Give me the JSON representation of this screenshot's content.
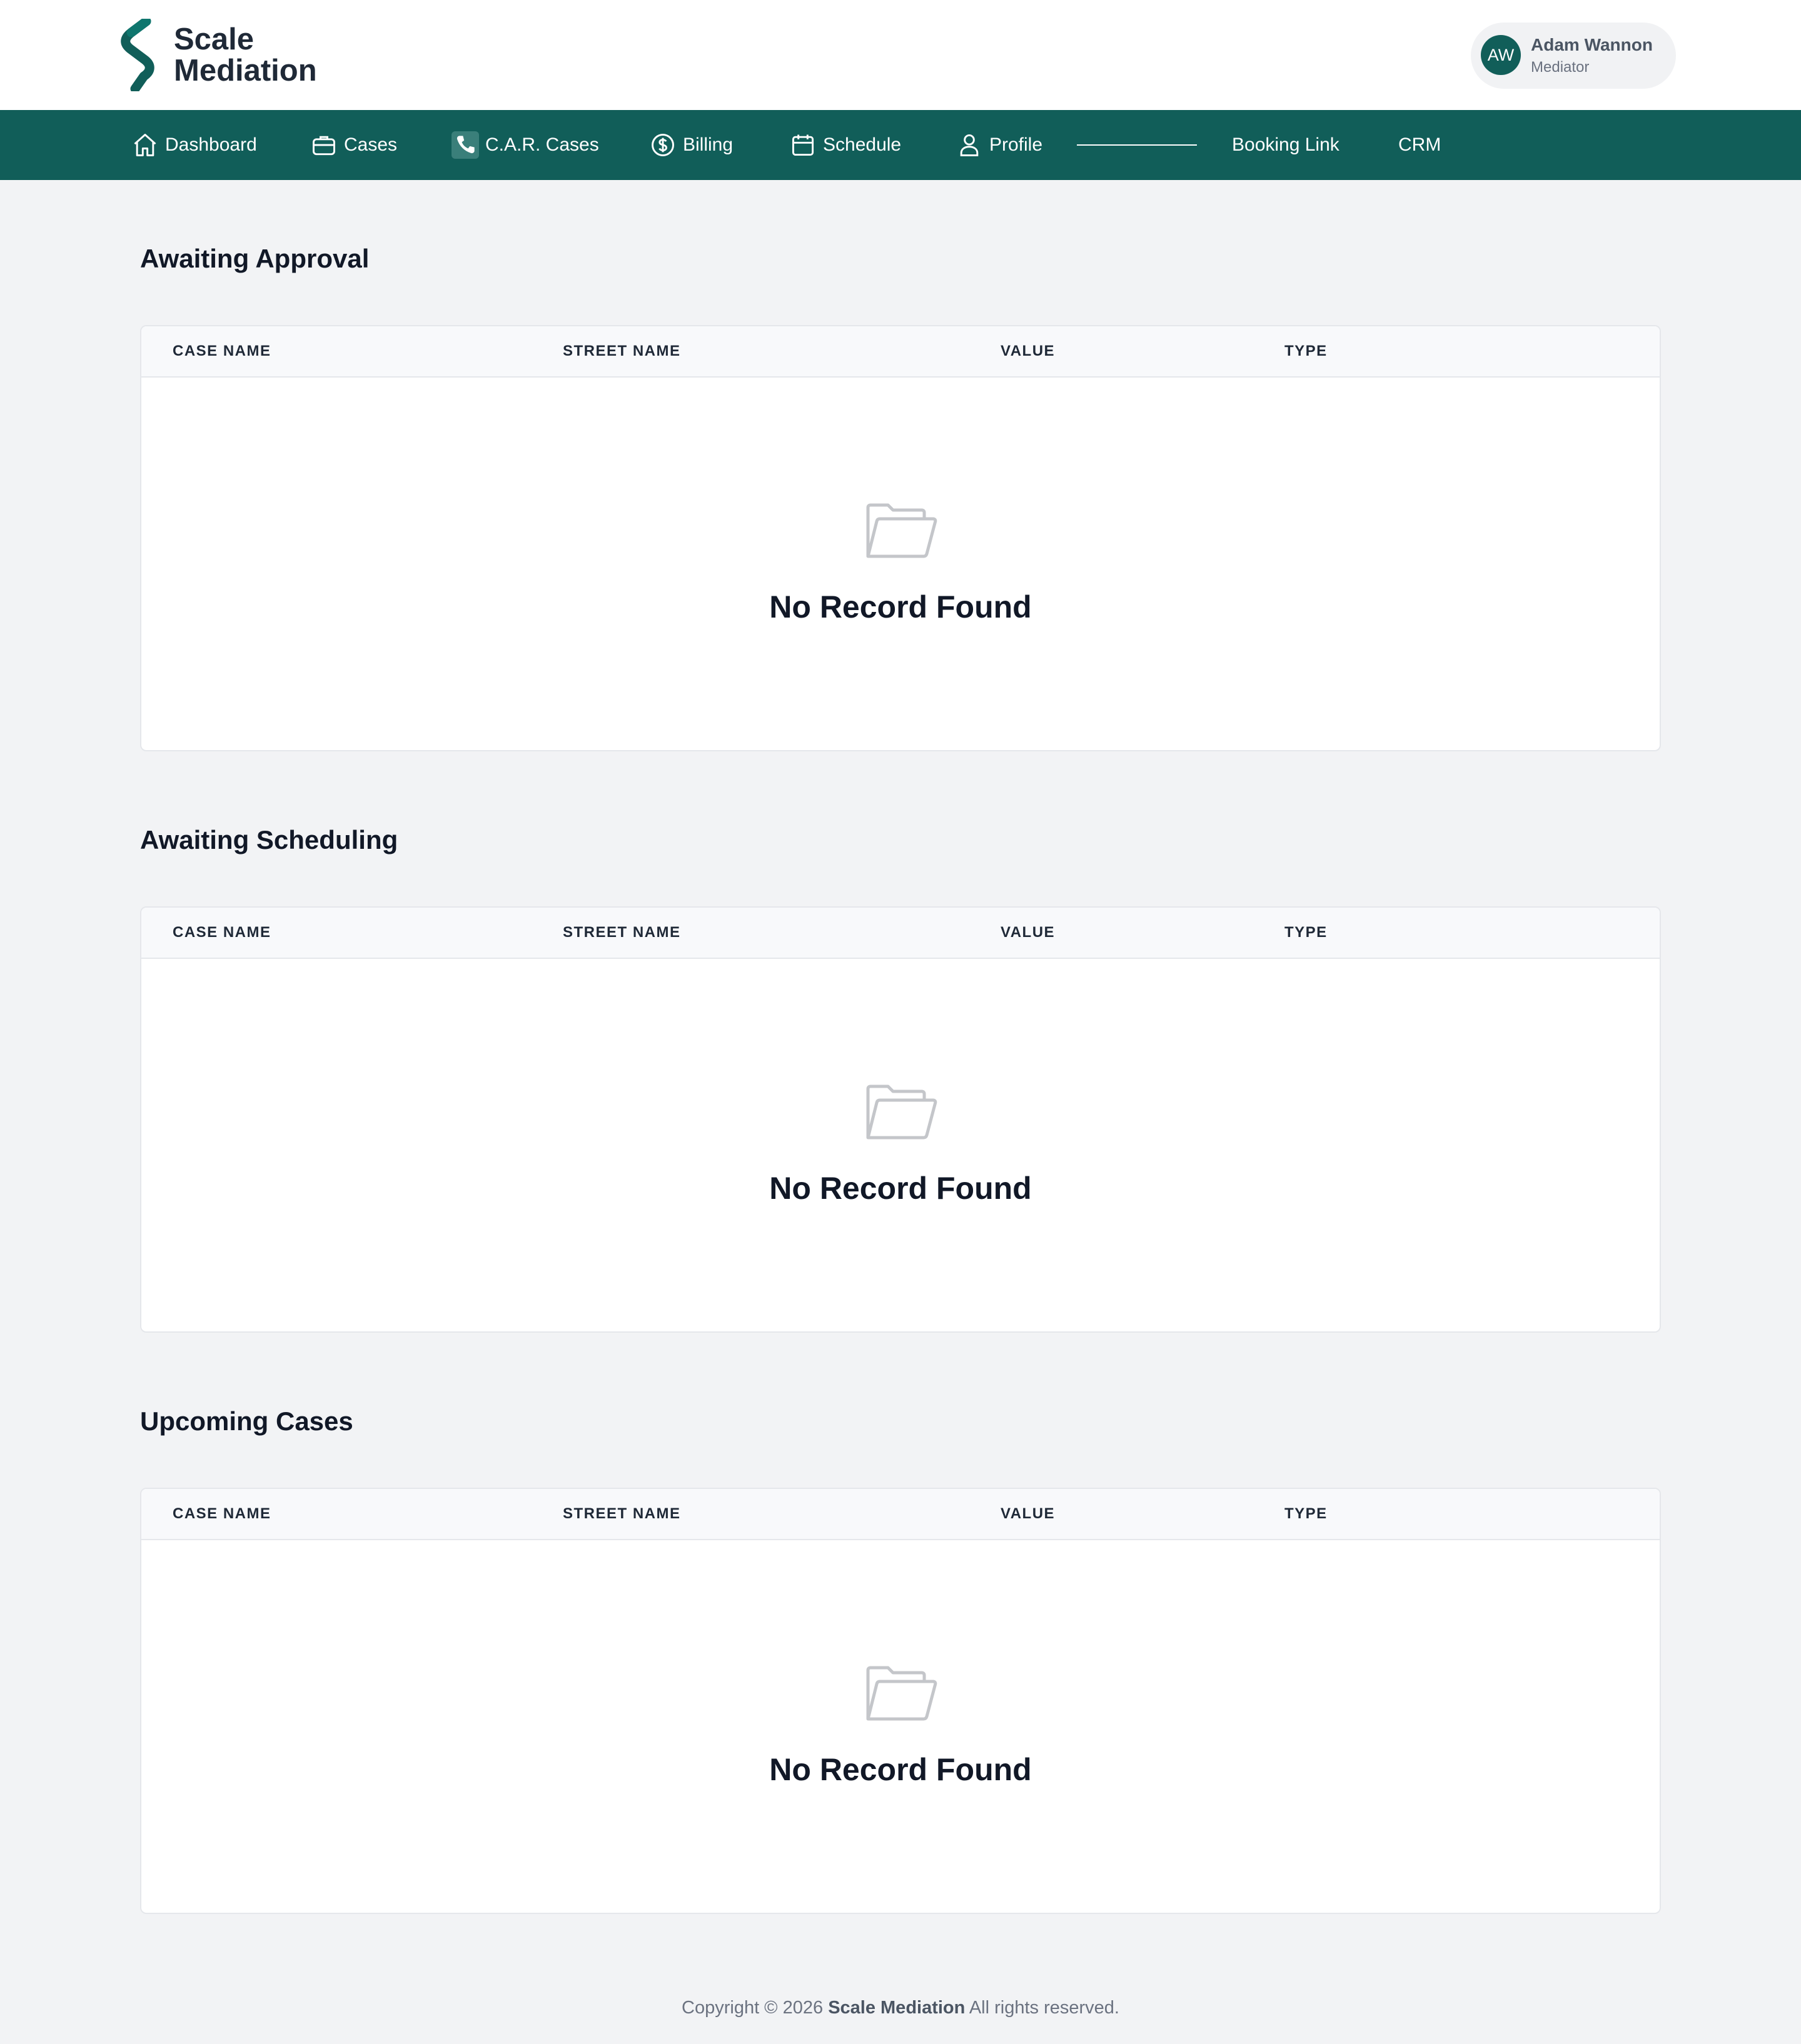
{
  "brand": {
    "line1": "Scale",
    "line2": "Mediation",
    "accent": "#115e59"
  },
  "user": {
    "initials": "AW",
    "name": "Adam Wannon",
    "role": "Mediator"
  },
  "nav": {
    "items": [
      {
        "label": "Dashboard",
        "icon": "home-icon"
      },
      {
        "label": "Cases",
        "icon": "briefcase-icon"
      },
      {
        "label": "C.A.R. Cases",
        "icon": "phone-icon"
      },
      {
        "label": "Billing",
        "icon": "dollar-circle-icon"
      },
      {
        "label": "Schedule",
        "icon": "calendar-icon"
      },
      {
        "label": "Profile",
        "icon": "user-icon"
      },
      {
        "label": "Booking Link"
      },
      {
        "label": "CRM"
      }
    ]
  },
  "sections": [
    {
      "title": "Awaiting Approval",
      "columns": [
        "CASE NAME",
        "STREET NAME",
        "VALUE",
        "TYPE"
      ],
      "empty_text": "No Record Found",
      "empty_icon": "folder-open-icon"
    },
    {
      "title": "Awaiting Scheduling",
      "columns": [
        "CASE NAME",
        "STREET NAME",
        "VALUE",
        "TYPE"
      ],
      "empty_text": "No Record Found",
      "empty_icon": "folder-open-icon"
    },
    {
      "title": "Upcoming Cases",
      "columns": [
        "CASE NAME",
        "STREET NAME",
        "VALUE",
        "TYPE"
      ],
      "empty_text": "No Record Found",
      "empty_icon": "folder-open-icon"
    }
  ],
  "footer": {
    "prefix": "Copyright © 2026",
    "brand": "Scale Mediation",
    "suffix": "All rights reserved."
  }
}
